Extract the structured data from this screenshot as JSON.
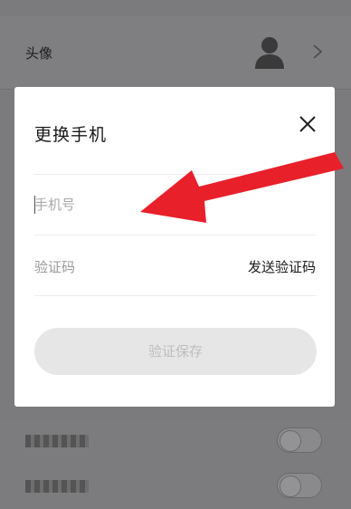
{
  "background": {
    "avatar_row": {
      "label": "头像"
    }
  },
  "dialog": {
    "title": "更换手机",
    "phone_placeholder": "手机号",
    "code_label": "验证码",
    "send_code_label": "发送验证码",
    "save_label": "验证保存"
  },
  "icons": {
    "close": "close-icon",
    "avatar": "user-silhouette-icon",
    "chevron": "chevron-right-icon"
  },
  "colors": {
    "overlay": "#7b7b7d",
    "dialog_bg": "#ffffff",
    "arrow": "#e8202a",
    "save_button_bg": "#e6e6e6",
    "save_button_text": "#bdbdbd"
  }
}
